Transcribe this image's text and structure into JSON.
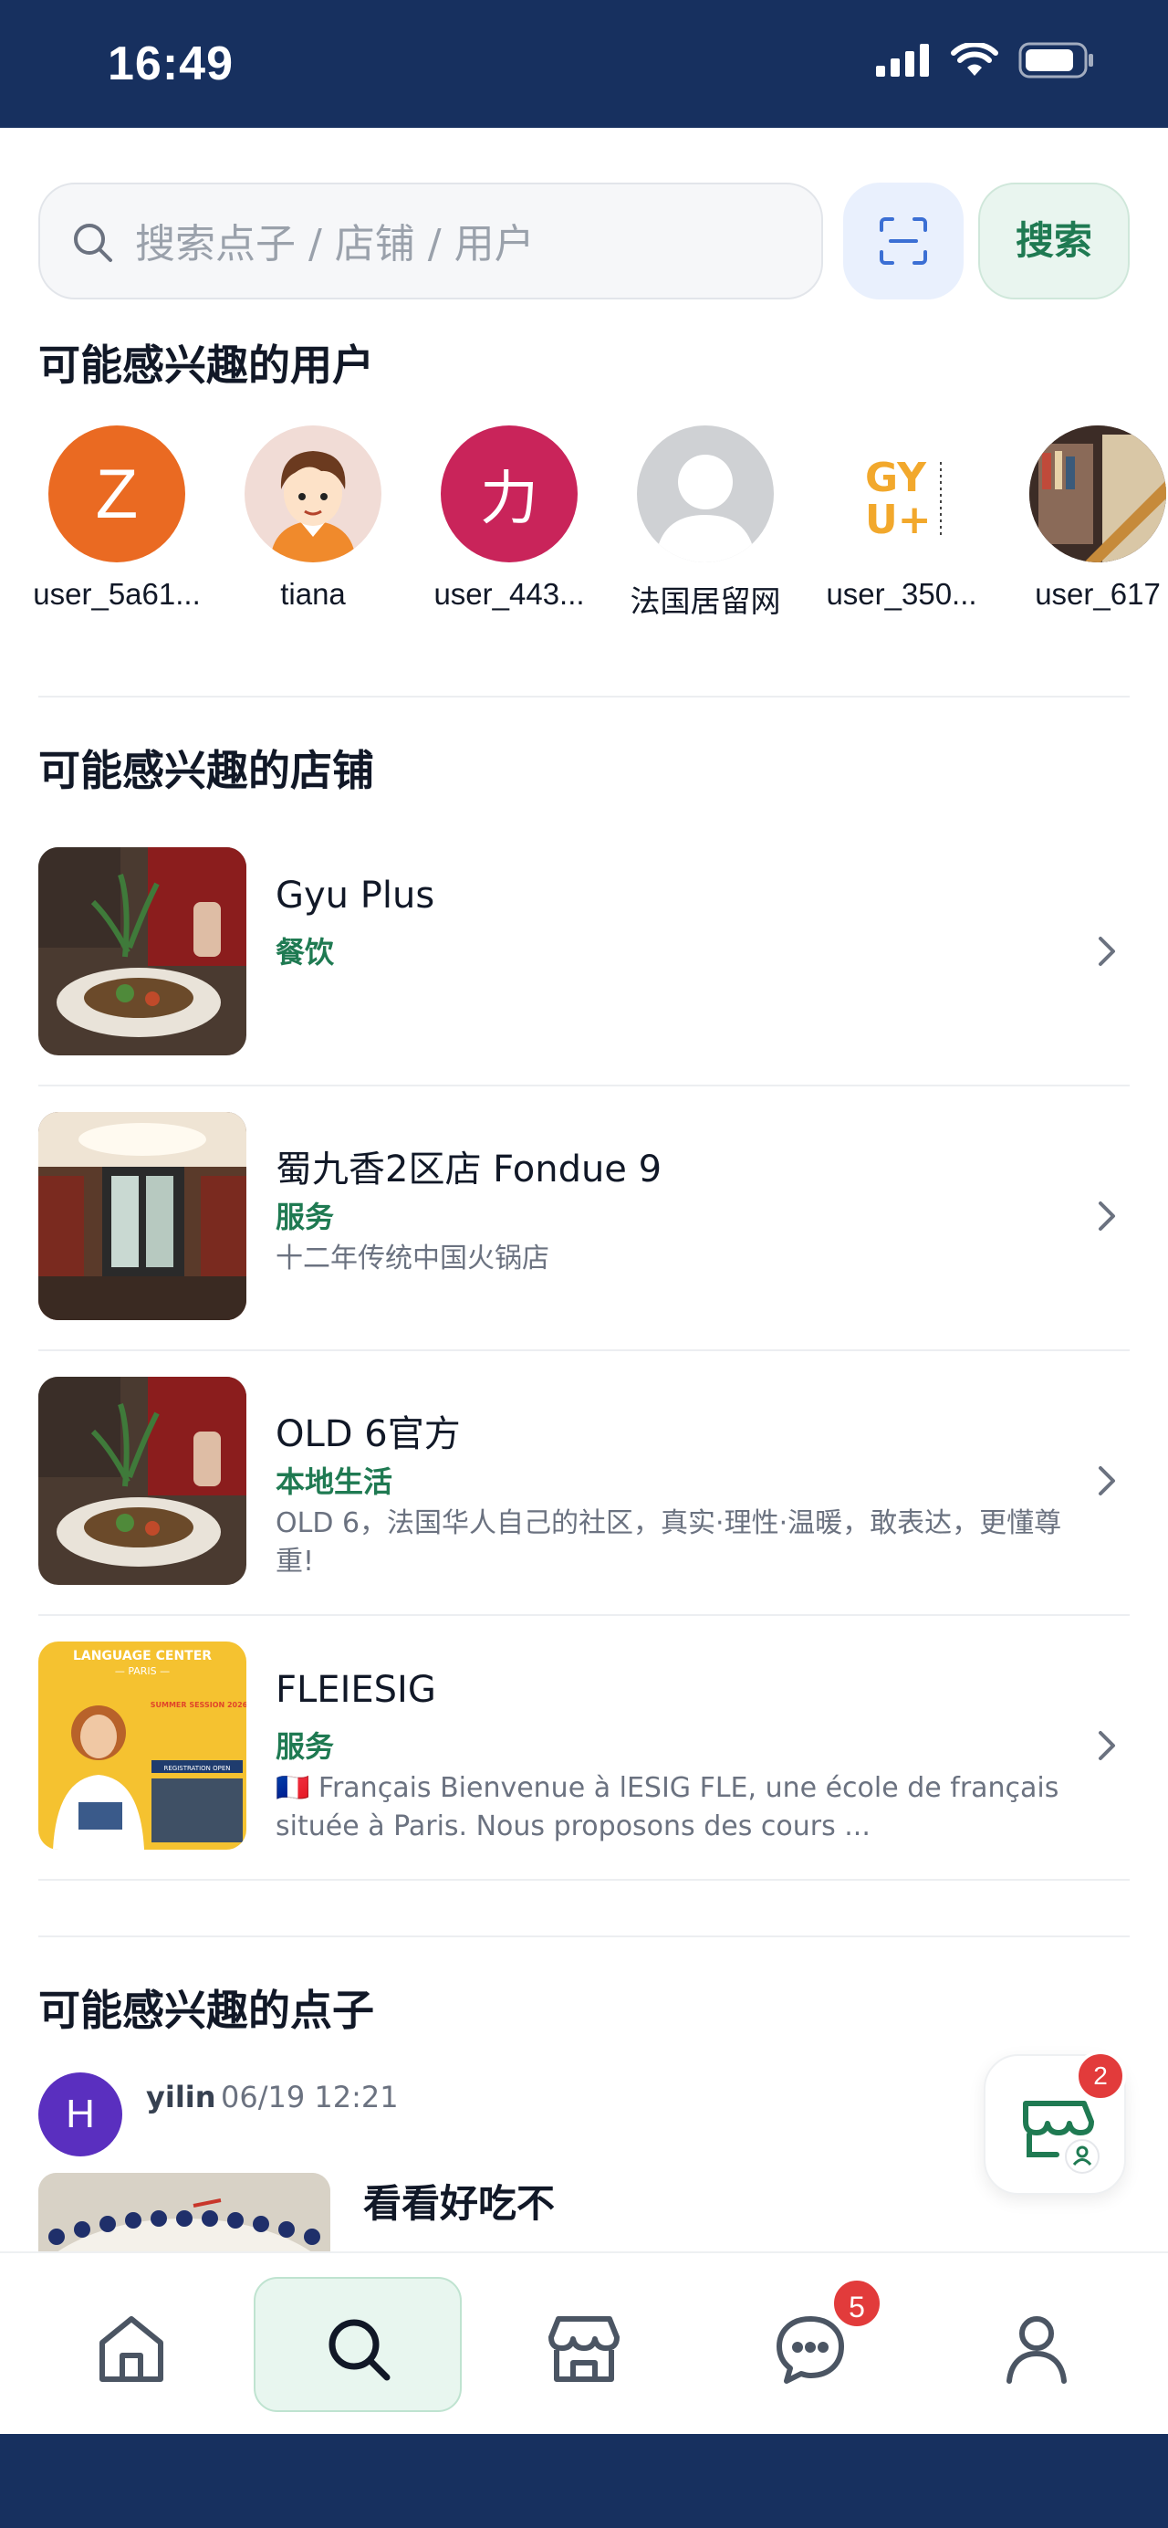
{
  "status_bar": {
    "time": "16:49",
    "icons": [
      "signal-icon",
      "wifi-icon",
      "battery-icon"
    ]
  },
  "search": {
    "placeholder": "搜索点子 / 店铺 / 用户",
    "button_label": "搜索",
    "scan_icon": "scan-icon"
  },
  "users_section": {
    "title": "可能感兴趣的用户",
    "users": [
      {
        "name": "user_5a61...",
        "initial": "Z",
        "color": "#ea6a22"
      },
      {
        "name": "tiana"
      },
      {
        "name": "user_443...",
        "initial": "力",
        "color": "#c9245a"
      },
      {
        "name": "法国居留网"
      },
      {
        "name": "user_350...",
        "logo": "GY U+"
      },
      {
        "name": "user_617"
      }
    ]
  },
  "shops_section": {
    "title": "可能感兴趣的店铺",
    "shops": [
      {
        "name": "Gyu Plus",
        "category": "餐饮",
        "description": ""
      },
      {
        "name": "蜀九香2区店 Fondue 9",
        "category": "服务",
        "description": "十二年传统中国火锅店"
      },
      {
        "name": "OLD 6官方",
        "category": "本地生活",
        "description": "OLD 6，法国华人自己的社区，真实·理性·温暖，敢表达，更懂尊重!"
      },
      {
        "name": "FLEIESIG",
        "category": "服务",
        "description": "🇫🇷 Français Bienvenue à lESIG FLE, une école de français située à Paris. Nous proposons des cours ...",
        "poster": {
          "top": "LANGUAGE CENTER",
          "city": "— PARIS —",
          "title": "SUMMER SESSION 2026",
          "tag": "REGISTRATION OPEN"
        }
      }
    ]
  },
  "ideas_section": {
    "title": "可能感兴趣的点子",
    "post": {
      "avatar_initial": "H",
      "author": "yilin",
      "date": "06/19 12:21",
      "title": "看看好吃不"
    }
  },
  "fab": {
    "icon": "store-user-icon",
    "badge": "2"
  },
  "tab_bar": {
    "tabs": [
      {
        "icon": "home-icon"
      },
      {
        "icon": "search-icon",
        "active": true
      },
      {
        "icon": "store-icon"
      },
      {
        "icon": "chat-icon",
        "badge": "5"
      },
      {
        "icon": "profile-icon"
      }
    ]
  },
  "colors": {
    "status_bar": "#17305f",
    "accent_green": "#1f7a52",
    "badge_red": "#e23b3b"
  }
}
